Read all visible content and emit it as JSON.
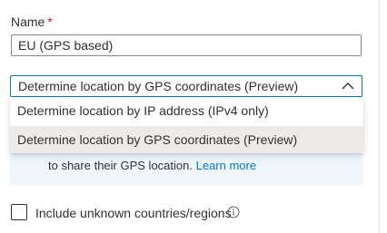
{
  "form": {
    "name_label": "Name",
    "name_required_marker": "*",
    "name_value": "EU (GPS based)",
    "method_select": {
      "selected_value": "Determine location by GPS coordinates (Preview)",
      "expanded": true,
      "options": [
        "Determine location by IP address (IPv4 only)",
        "Determine location by GPS coordinates (Preview)"
      ],
      "highlighted_index": 1
    },
    "info_panel": {
      "text": "to share their GPS location.",
      "link_text": "Learn more"
    },
    "include_unknown": {
      "label": "Include unknown countries/regions",
      "checked": false
    }
  },
  "colors": {
    "accent": "#0078d4",
    "required": "#a4262c",
    "info_bg": "#eff6fc",
    "highlight_bg": "#edebe9"
  },
  "icons": {
    "select_chevron": "chevron-up-icon",
    "help": "info-circle-icon"
  }
}
